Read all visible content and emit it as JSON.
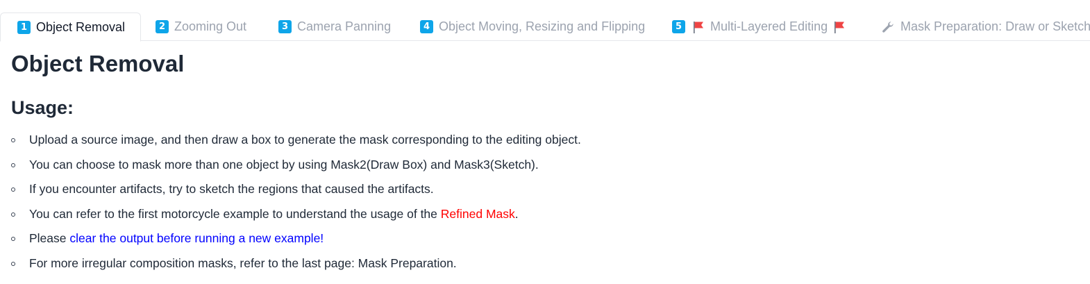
{
  "tabs": [
    {
      "badge": "1",
      "label": "Object Removal",
      "active": true
    },
    {
      "badge": "2",
      "label": "Zooming Out",
      "active": false
    },
    {
      "badge": "3",
      "label": "Camera Panning",
      "active": false
    },
    {
      "badge": "4",
      "label": "Object Moving, Resizing and Flipping",
      "active": false
    },
    {
      "badge": "5",
      "label": "Multi-Layered Editing",
      "active": false,
      "icon": "red-flag-icon"
    },
    {
      "label": "Mask Preparation: Draw or Sketch",
      "active": false,
      "icon": "wrench-icon"
    }
  ],
  "main": {
    "title": "Object Removal",
    "usage_heading": "Usage:",
    "items": [
      {
        "text": "Upload a source image, and then draw a box to generate the mask corresponding to the editing object."
      },
      {
        "text": "You can choose to mask more than one object by using Mask2(Draw Box) and Mask3(Sketch)."
      },
      {
        "text": "If you encounter artifacts, try to sketch the regions that caused the artifacts."
      },
      {
        "text_before": "You can refer to the first motorcycle example to understand the usage of the ",
        "highlight": "Refined Mask",
        "text_after": "."
      },
      {
        "text_before": "Please ",
        "link": "clear the output before running a new example!"
      },
      {
        "text": "For more irregular composition masks, refer to the last page: Mask Preparation."
      }
    ]
  },
  "colors": {
    "badge": "#0ea5e9",
    "highlight_red": "#ff0000",
    "link_blue": "#0000ff",
    "flag_red": "#ef4444"
  }
}
